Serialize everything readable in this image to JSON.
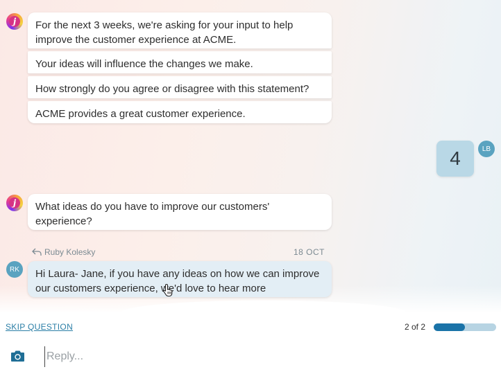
{
  "conversation": {
    "bot_avatar_letter": "j",
    "first_message": [
      "For the next 3 weeks, we're asking for your input to help improve the customer experience at ACME.",
      "Your ideas will influence the changes we make.",
      "How strongly do you agree or disagree with this statement?",
      "ACME provides a great customer experience."
    ],
    "user_answer": "4",
    "user_initials": "LB",
    "second_message": "What ideas do you have to improve our customers' experience?",
    "reply_author": "Ruby Kolesky",
    "reply_date": "18 OCT",
    "reply_initials": "RK",
    "reply_message": "Hi Laura- Jane, if you have any ideas on how we can improve our customers experience, we'd love to hear more"
  },
  "footer": {
    "skip_label": "SKIP QUESTION",
    "progress_label": "2 of 2",
    "progress_fraction": 0.5,
    "progress_color": "#1a73a8",
    "track_color": "#b7d4e3"
  },
  "composer": {
    "camera_icon": "camera-icon",
    "reply_placeholder": "Reply..."
  }
}
